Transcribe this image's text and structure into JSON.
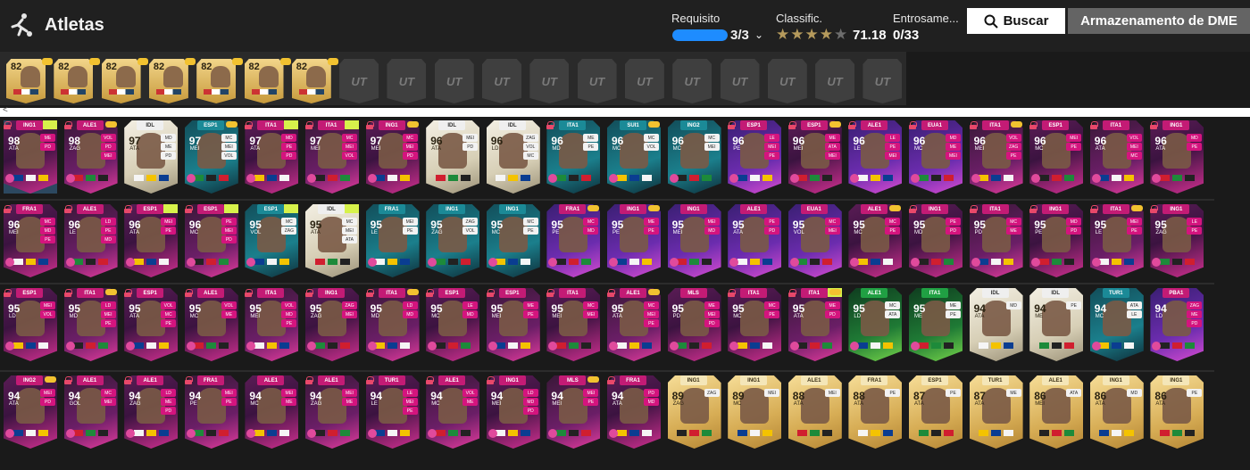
{
  "header": {
    "title": "Atletas",
    "requirement": {
      "label": "Requisito",
      "count": "3/3",
      "progress": 1.0
    },
    "rating": {
      "label": "Classific.",
      "value": "71.18",
      "stars_on": 3,
      "stars_half": 1,
      "stars_total": 5
    },
    "chemistry": {
      "label": "Entrosame...",
      "value": "0/33"
    },
    "search_label": "Buscar",
    "storage_label": "Armazenamento de DME"
  },
  "squad": {
    "filled": [
      {
        "rating": "82"
      },
      {
        "rating": "82"
      },
      {
        "rating": "82"
      },
      {
        "rating": "82"
      },
      {
        "rating": "82"
      },
      {
        "rating": "82"
      },
      {
        "rating": "82"
      }
    ],
    "empty_slots": 12,
    "empty_label": "UT"
  },
  "cards": [
    {
      "rating": "98",
      "pos": "ATA",
      "league": "ING1",
      "style": "pink",
      "chips": [
        "ME",
        "PD"
      ],
      "lock": true,
      "chem": false,
      "lime": true,
      "selected": true
    },
    {
      "rating": "98",
      "pos": "ZAG",
      "league": "ALE1",
      "style": "pink2",
      "chips": [
        "VOL",
        "PD",
        "MEI"
      ],
      "lock": true,
      "chem": true
    },
    {
      "rating": "97",
      "pos": "ATA",
      "league": "IDL",
      "style": "icon",
      "chips": [
        "MD",
        "ME",
        "PD"
      ],
      "lock": false,
      "chem": false
    },
    {
      "rating": "97",
      "pos": "MEI",
      "league": "ESP1",
      "style": "teal",
      "chips": [
        "MC",
        "MEI",
        "VOL"
      ],
      "lock": false,
      "chem": true
    },
    {
      "rating": "97",
      "pos": "ATA",
      "league": "ITA1",
      "style": "pink",
      "chips": [
        "MD",
        "PE",
        "PD"
      ],
      "lock": true,
      "chem": false,
      "lime": true
    },
    {
      "rating": "97",
      "pos": "MEI",
      "league": "ITA1",
      "style": "pink2",
      "chips": [
        "MC",
        "MEI",
        "VOL"
      ],
      "lock": true,
      "chem": false,
      "lime": true
    },
    {
      "rating": "97",
      "pos": "MEI",
      "league": "ING1",
      "style": "pink",
      "chips": [
        "MC",
        "MEI",
        "PD"
      ],
      "lock": true,
      "chem": true
    },
    {
      "rating": "96",
      "pos": "ATA",
      "league": "IDL",
      "style": "icon",
      "chips": [
        "MEI",
        "PD"
      ],
      "lock": false,
      "chem": false
    },
    {
      "rating": "96",
      "pos": "LD",
      "league": "IDL",
      "style": "icon",
      "chips": [
        "ZAG",
        "VOL",
        "MC"
      ],
      "lock": false,
      "chem": false
    },
    {
      "rating": "96",
      "pos": "MD",
      "league": "ITA1",
      "style": "teal",
      "chips": [
        "ME",
        "PE"
      ],
      "lock": true,
      "chem": false
    },
    {
      "rating": "96",
      "pos": "MC",
      "league": "SUI1",
      "style": "teal",
      "chips": [
        "MC",
        "VOL"
      ],
      "lock": false,
      "chem": true
    },
    {
      "rating": "96",
      "pos": "MC",
      "league": "ING2",
      "style": "teal",
      "chips": [
        "MC",
        "MEI"
      ],
      "lock": false,
      "chem": false
    },
    {
      "rating": "96",
      "pos": "PE",
      "league": "ESP1",
      "style": "purple",
      "chips": [
        "LE",
        "MEI",
        "PE"
      ],
      "lock": true,
      "chem": false
    },
    {
      "rating": "96",
      "pos": "MEI",
      "league": "ESP1",
      "style": "pink",
      "chips": [
        "ME",
        "ATA",
        "MEI"
      ],
      "lock": true,
      "chem": true
    },
    {
      "rating": "96",
      "pos": "LE",
      "league": "ALE1",
      "style": "purple",
      "chips": [
        "LE",
        "PE",
        "MEI"
      ],
      "lock": true,
      "chem": false
    },
    {
      "rating": "96",
      "pos": "MC",
      "league": "EUA1",
      "style": "purple",
      "chips": [
        "MD",
        "ME",
        "MEI"
      ],
      "lock": true,
      "chem": false
    },
    {
      "rating": "96",
      "pos": "MEI",
      "league": "ITA1",
      "style": "pink2",
      "chips": [
        "VOL",
        "ZAG",
        "PE"
      ],
      "lock": true,
      "chem": true
    },
    {
      "rating": "96",
      "pos": "MC",
      "league": "ESP1",
      "style": "pink",
      "chips": [
        "MEI",
        "PE"
      ],
      "lock": true,
      "chem": false
    },
    {
      "rating": "96",
      "pos": "ATA",
      "league": "ITA1",
      "style": "pink2",
      "chips": [
        "VOL",
        "MEI",
        "MC"
      ],
      "lock": true,
      "chem": false
    },
    {
      "rating": "96",
      "pos": "ATA",
      "league": "ING1",
      "style": "pink",
      "chips": [
        "MD",
        "PE"
      ],
      "lock": true,
      "chem": false
    },
    {
      "rating": "96",
      "pos": "MEI",
      "league": "FRA1",
      "style": "pink",
      "chips": [
        "MC",
        "MD",
        "PE"
      ],
      "lock": true,
      "chem": false
    },
    {
      "rating": "96",
      "pos": "LE",
      "league": "ALE1",
      "style": "pink2",
      "chips": [
        "LD",
        "PE",
        "MD"
      ],
      "lock": true,
      "chem": false
    },
    {
      "rating": "96",
      "pos": "ATA",
      "league": "ESP1",
      "style": "pink",
      "chips": [
        "MEI",
        "PE"
      ],
      "lock": true,
      "chem": false,
      "lime": true
    },
    {
      "rating": "96",
      "pos": "MC",
      "league": "ESP1",
      "style": "pink2",
      "chips": [
        "PE",
        "MEI",
        "PD"
      ],
      "lock": true,
      "chem": false,
      "lime": true
    },
    {
      "rating": "95",
      "pos": "VOL",
      "league": "ESP1",
      "style": "teal",
      "chips": [
        "MC",
        "ZAG"
      ],
      "lock": false,
      "chem": false,
      "lime": true
    },
    {
      "rating": "95",
      "pos": "ATA",
      "league": "IDL",
      "style": "icon",
      "chips": [
        "MC",
        "MEI",
        "ATA"
      ],
      "lock": false,
      "chem": false,
      "lime": true
    },
    {
      "rating": "95",
      "pos": "LE",
      "league": "FRA1",
      "style": "teal",
      "chips": [
        "MEI",
        "PE"
      ],
      "lock": false,
      "chem": false
    },
    {
      "rating": "95",
      "pos": "ZAG",
      "league": "ING1",
      "style": "teal",
      "chips": [
        "ZAG",
        "VOL"
      ],
      "lock": false,
      "chem": false
    },
    {
      "rating": "95",
      "pos": "MC",
      "league": "ING1",
      "style": "teal",
      "chips": [
        "MC",
        "PE"
      ],
      "lock": false,
      "chem": false
    },
    {
      "rating": "95",
      "pos": "PE",
      "league": "FRA1",
      "style": "purple",
      "chips": [
        "MC",
        "MD"
      ],
      "lock": false,
      "chem": true
    },
    {
      "rating": "95",
      "pos": "PE",
      "league": "ING1",
      "style": "purple",
      "chips": [
        "ME",
        "PE"
      ],
      "lock": false,
      "chem": true
    },
    {
      "rating": "95",
      "pos": "MEI",
      "league": "ING1",
      "style": "purple",
      "chips": [
        "MEI",
        "MD"
      ],
      "lock": false,
      "chem": false
    },
    {
      "rating": "95",
      "pos": "ATA",
      "league": "ALE1",
      "style": "purple",
      "chips": [
        "PE",
        "PD"
      ],
      "lock": false,
      "chem": false
    },
    {
      "rating": "95",
      "pos": "VOL",
      "league": "EUA1",
      "style": "purple",
      "chips": [
        "MC",
        "MEI"
      ],
      "lock": false,
      "chem": false
    },
    {
      "rating": "95",
      "pos": "MC",
      "league": "ALE1",
      "style": "pink",
      "chips": [
        "MC",
        "PE"
      ],
      "lock": false,
      "chem": true
    },
    {
      "rating": "95",
      "pos": "MD",
      "league": "ING1",
      "style": "pink",
      "chips": [
        "PE",
        "PD"
      ],
      "lock": true,
      "chem": false
    },
    {
      "rating": "95",
      "pos": "PD",
      "league": "ITA1",
      "style": "pink2",
      "chips": [
        "MC",
        "ME"
      ],
      "lock": true,
      "chem": false
    },
    {
      "rating": "95",
      "pos": "PE",
      "league": "ING1",
      "style": "pink",
      "chips": [
        "MD",
        "PD"
      ],
      "lock": true,
      "chem": false
    },
    {
      "rating": "95",
      "pos": "LE",
      "league": "ITA1",
      "style": "pink2",
      "chips": [
        "MEI",
        "PE"
      ],
      "lock": true,
      "chem": true
    },
    {
      "rating": "95",
      "pos": "ZAG",
      "league": "ING1",
      "style": "pink",
      "chips": [
        "LE",
        "PE"
      ],
      "lock": true,
      "chem": false
    },
    {
      "rating": "95",
      "pos": "LD",
      "league": "ESP1",
      "style": "pink",
      "chips": [
        "MEI",
        "VOL"
      ],
      "lock": true,
      "chem": false
    },
    {
      "rating": "95",
      "pos": "MD",
      "league": "ITA1",
      "style": "pink2",
      "chips": [
        "LD",
        "MEI",
        "PE"
      ],
      "lock": true,
      "chem": true
    },
    {
      "rating": "95",
      "pos": "ATA",
      "league": "ESP1",
      "style": "pink",
      "chips": [
        "VOL",
        "MC",
        "PE"
      ],
      "lock": true,
      "chem": false
    },
    {
      "rating": "95",
      "pos": "MC",
      "league": "ALE1",
      "style": "pink",
      "chips": [
        "VOL",
        "ME"
      ],
      "lock": true,
      "chem": false
    },
    {
      "rating": "95",
      "pos": "MEI",
      "league": "ITA1",
      "style": "pink2",
      "chips": [
        "VOL",
        "MD",
        "PE"
      ],
      "lock": true,
      "chem": false
    },
    {
      "rating": "95",
      "pos": "ZAG",
      "league": "ING1",
      "style": "pink",
      "chips": [
        "ZAG",
        "MEI"
      ],
      "lock": true,
      "chem": false
    },
    {
      "rating": "95",
      "pos": "MD",
      "league": "ITA1",
      "style": "pink2",
      "chips": [
        "LD",
        "MD"
      ],
      "lock": true,
      "chem": true
    },
    {
      "rating": "95",
      "pos": "MC",
      "league": "ESP1",
      "style": "pink",
      "chips": [
        "LE",
        "MD"
      ],
      "lock": true,
      "chem": false
    },
    {
      "rating": "95",
      "pos": "MEI",
      "league": "ESP1",
      "style": "pink2",
      "chips": [
        "ME",
        "PE"
      ],
      "lock": true,
      "chem": false
    },
    {
      "rating": "95",
      "pos": "MEI",
      "league": "ITA1",
      "style": "pink",
      "chips": [
        "MC",
        "MEI"
      ],
      "lock": true,
      "chem": false
    },
    {
      "rating": "95",
      "pos": "ATA",
      "league": "ALE1",
      "style": "pink2",
      "chips": [
        "MC",
        "MEI",
        "PE"
      ],
      "lock": true,
      "chem": true
    },
    {
      "rating": "95",
      "pos": "PD",
      "league": "MLS",
      "style": "pink",
      "chips": [
        "ME",
        "MEI",
        "PD"
      ],
      "lock": false,
      "chem": false
    },
    {
      "rating": "95",
      "pos": "MC",
      "league": "ITA1",
      "style": "pink",
      "chips": [
        "MC",
        "PE"
      ],
      "lock": true,
      "chem": false
    },
    {
      "rating": "95",
      "pos": "ATA",
      "league": "ITA1",
      "style": "pink2",
      "chips": [
        "ME",
        "PD"
      ],
      "lock": true,
      "chem": true,
      "lime": true
    },
    {
      "rating": "95",
      "pos": "LD",
      "league": "ALE1",
      "style": "green",
      "chips": [
        "MC",
        "ATA"
      ],
      "lock": false,
      "chem": false
    },
    {
      "rating": "95",
      "pos": "ME",
      "league": "ITA1",
      "style": "green",
      "chips": [
        "ME",
        "PE"
      ],
      "lock": false,
      "chem": false
    },
    {
      "rating": "94",
      "pos": "ATA",
      "league": "IDL",
      "style": "icon",
      "chips": [
        "MD"
      ],
      "lock": false,
      "chem": false
    },
    {
      "rating": "94",
      "pos": "ME",
      "league": "IDL",
      "style": "icon",
      "chips": [
        "PE"
      ],
      "lock": false,
      "chem": false
    },
    {
      "rating": "94",
      "pos": "MC",
      "league": "TUR1",
      "style": "teal",
      "chips": [
        "ATA",
        "LE"
      ],
      "lock": false,
      "chem": false
    },
    {
      "rating": "94",
      "pos": "LD",
      "league": "PBA1",
      "style": "purple",
      "chips": [
        "ZAG",
        "ME",
        "PD"
      ],
      "lock": false,
      "chem": false
    },
    {
      "rating": "94",
      "pos": "ATA",
      "league": "ING2",
      "style": "pink",
      "chips": [
        "MEI",
        "PD"
      ],
      "lock": false,
      "chem": true
    },
    {
      "rating": "94",
      "pos": "GOL",
      "league": "ALE1",
      "style": "pink2",
      "chips": [
        "MC",
        "MEI"
      ],
      "lock": true,
      "chem": false
    },
    {
      "rating": "94",
      "pos": "ZAG",
      "league": "ALE1",
      "style": "pink",
      "chips": [
        "LD",
        "ME",
        "PD"
      ],
      "lock": true,
      "chem": false
    },
    {
      "rating": "94",
      "pos": "PE",
      "league": "FRA1",
      "style": "pink2",
      "chips": [
        "MEI",
        "PE"
      ],
      "lock": true,
      "chem": false
    },
    {
      "rating": "94",
      "pos": "MC",
      "league": "ALE1",
      "style": "pink",
      "chips": [
        "MEI",
        "ME"
      ],
      "lock": false,
      "chem": false
    },
    {
      "rating": "94",
      "pos": "ZAG",
      "league": "ALE1",
      "style": "pink2",
      "chips": [
        "MEI",
        "ME"
      ],
      "lock": true,
      "chem": false
    },
    {
      "rating": "94",
      "pos": "LE",
      "league": "TUR1",
      "style": "pink",
      "chips": [
        "LE",
        "MEI",
        "PE"
      ],
      "lock": true,
      "chem": false
    },
    {
      "rating": "94",
      "pos": "MC",
      "league": "ALE1",
      "style": "pink2",
      "chips": [
        "VOL",
        "ME"
      ],
      "lock": true,
      "chem": false
    },
    {
      "rating": "94",
      "pos": "MEI",
      "league": "ING1",
      "style": "pink",
      "chips": [
        "LD",
        "MD",
        "PD"
      ],
      "lock": true,
      "chem": false
    },
    {
      "rating": "94",
      "pos": "MEI",
      "league": "MLS",
      "style": "pink2",
      "chips": [
        "MEI",
        "PE"
      ],
      "lock": false,
      "chem": true
    },
    {
      "rating": "94",
      "pos": "ATA",
      "league": "FRA1",
      "style": "pink",
      "chips": [
        "PD",
        "MD"
      ],
      "lock": true,
      "chem": false
    },
    {
      "rating": "89",
      "pos": "ZAG",
      "league": "ING1",
      "style": "gold",
      "chips": [
        "ZAG"
      ],
      "lock": false,
      "chem": false
    },
    {
      "rating": "89",
      "pos": "MC",
      "league": "ING1",
      "style": "gold",
      "chips": [
        "MEI"
      ],
      "lock": false,
      "chem": false
    },
    {
      "rating": "88",
      "pos": "ATA",
      "league": "ALE1",
      "style": "gold",
      "chips": [
        "MEI"
      ],
      "lock": false,
      "chem": false
    },
    {
      "rating": "88",
      "pos": "ATA",
      "league": "FRA1",
      "style": "gold",
      "chips": [
        "PE"
      ],
      "lock": false,
      "chem": false
    },
    {
      "rating": "87",
      "pos": "ATA",
      "league": "ESP1",
      "style": "gold",
      "chips": [
        "PE"
      ],
      "lock": false,
      "chem": false
    },
    {
      "rating": "87",
      "pos": "ATA",
      "league": "TUR1",
      "style": "gold",
      "chips": [
        "ME"
      ],
      "lock": false,
      "chem": false
    },
    {
      "rating": "86",
      "pos": "MEI",
      "league": "ALE1",
      "style": "gold",
      "chips": [
        "ATA"
      ],
      "lock": false,
      "chem": false
    },
    {
      "rating": "86",
      "pos": "ATA",
      "league": "ING1",
      "style": "gold",
      "chips": [
        "MD"
      ],
      "lock": false,
      "chem": false
    },
    {
      "rating": "86",
      "pos": "ATA",
      "league": "ING1",
      "style": "gold",
      "chips": [
        "PE"
      ],
      "lock": false,
      "chem": false
    }
  ]
}
